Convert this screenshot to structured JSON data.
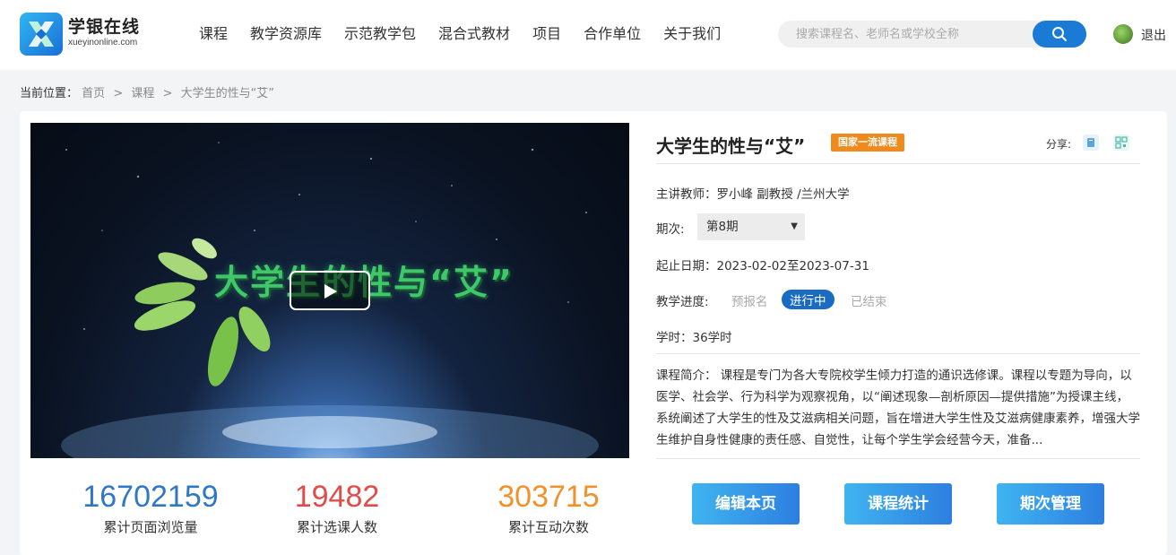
{
  "header": {
    "logo_title": "学银在线",
    "logo_subtitle": "xueyinonline.com",
    "nav": [
      "课程",
      "教学资源库",
      "示范教学包",
      "混合式教材",
      "项目",
      "合作单位",
      "关于我们"
    ],
    "search_placeholder": "搜索课程名、老师名或学校全称",
    "logout": "退出"
  },
  "breadcrumb": {
    "label": "当前位置：",
    "items": [
      "首页",
      "课程",
      "大学生的性与“艾”"
    ],
    "separator": ">"
  },
  "video": {
    "overlay_title": "大学生的性与“艾”"
  },
  "stats": [
    {
      "value": "16702159",
      "label": "累计页面浏览量",
      "color": "#2f78c4"
    },
    {
      "value": "19482",
      "label": "累计选课人数",
      "color": "#e04c48"
    },
    {
      "value": "303715",
      "label": "累计互动次数",
      "color": "#f0922c"
    }
  ],
  "course": {
    "title": "大学生的性与“艾”",
    "badge": "国家一流课程",
    "share_label": "分享:",
    "teacher": "主讲教师：罗小峰 副教授 /兰州大学",
    "term_label": "期次:",
    "term_value": "第8期",
    "dates": "起止日期：2023-02-02至2023-07-31",
    "progress_label": "教学进度:",
    "progress_states": [
      "预报名",
      "进行中",
      "已结束"
    ],
    "hours": "学时：36学时",
    "intro": "课程简介：  课程是专门为各大专院校学生倾力打造的通识选修课。课程以专题为导向，以医学、社会学、行为科学为观察视角，以“阐述现象—剖析原因—提供措施”为授课主线，系统阐述了大学生的性及艾滋病相关问题，旨在增进大学生性及艾滋病健康素养，增强大学生维护自身性健康的责任感、自觉性，让每个学生学会经营今天，准备..."
  },
  "actions": [
    "编辑本页",
    "课程统计",
    "期次管理"
  ]
}
